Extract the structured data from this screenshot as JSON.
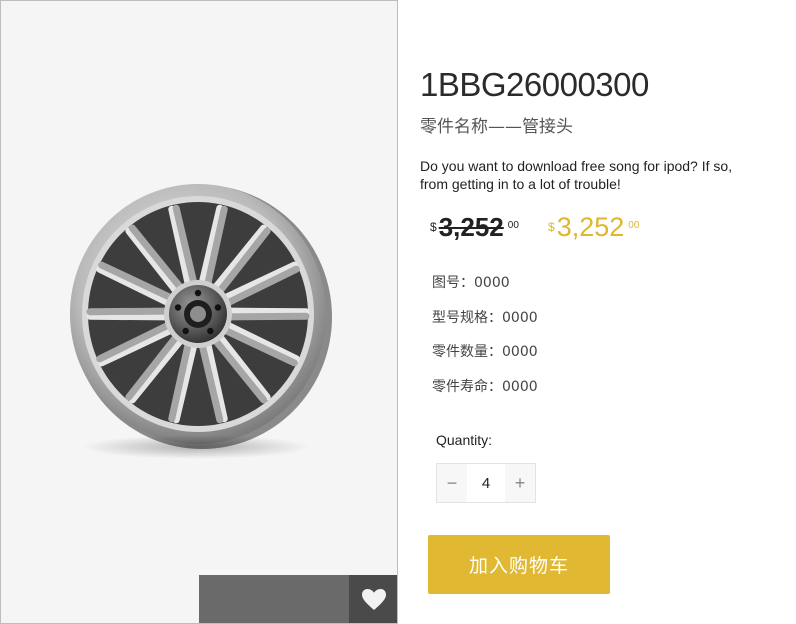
{
  "product": {
    "part_number": "1BBG26000300",
    "part_name": "零件名称——管接头",
    "description": "Do you want to download free song for ipod? If so, from getting in to a lot of trouble!",
    "image_icon": "alloy-wheel-image"
  },
  "price": {
    "currency_symbol": "$",
    "old_main": "3,252",
    "old_cents": "00",
    "new_main": "3,252",
    "new_cents": "00",
    "accent_color": "#e0b62e"
  },
  "specs": [
    {
      "label": "图号：",
      "value": "0000"
    },
    {
      "label": "型号规格：",
      "value": "0000"
    },
    {
      "label": "零件数量：",
      "value": "0000"
    },
    {
      "label": "零件寿命：",
      "value": "0000"
    }
  ],
  "quantity": {
    "label": "Quantity:",
    "value": "4",
    "minus": "−",
    "plus": "+"
  },
  "actions": {
    "add_to_cart": "加入购物车",
    "wishlist_icon": "heart-icon"
  }
}
